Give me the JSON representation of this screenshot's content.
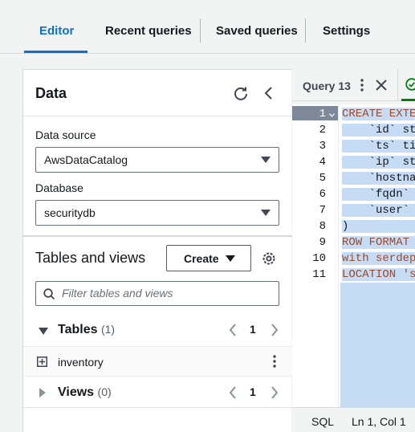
{
  "tabs": [
    {
      "label": "Editor",
      "active": true
    },
    {
      "label": "Recent queries",
      "active": false
    },
    {
      "label": "Saved queries",
      "active": false
    },
    {
      "label": "Settings",
      "active": false
    }
  ],
  "data_panel": {
    "title": "Data",
    "data_source": {
      "label": "Data source",
      "value": "AwsDataCatalog"
    },
    "database": {
      "label": "Database",
      "value": "securitydb"
    },
    "tables_and_views": {
      "title": "Tables and views",
      "create_label": "Create",
      "filter_placeholder": "Filter tables and views"
    },
    "tables_group": {
      "label": "Tables",
      "count": "(1)",
      "page": "1"
    },
    "table_items": [
      {
        "label": "inventory"
      }
    ],
    "views_group": {
      "label": "Views",
      "count": "(0)",
      "page": "1"
    }
  },
  "editor": {
    "query_tab": "Query 13",
    "lines": [
      {
        "n": "1",
        "text": "CREATE EXTE"
      },
      {
        "n": "2",
        "text": "    `id` st"
      },
      {
        "n": "3",
        "text": "    `ts` ti"
      },
      {
        "n": "4",
        "text": "    `ip` st"
      },
      {
        "n": "5",
        "text": "    `hostna"
      },
      {
        "n": "6",
        "text": "    `fqdn` "
      },
      {
        "n": "7",
        "text": "    `user` "
      },
      {
        "n": "8",
        "text": ")"
      },
      {
        "n": "9",
        "text": "ROW FORMAT "
      },
      {
        "n": "10",
        "text": "with serdep"
      },
      {
        "n": "11",
        "text": "LOCATION 's"
      }
    ],
    "status_language": "SQL",
    "status_position": "Ln 1, Col 1"
  },
  "colors": {
    "accent": "#0972d3",
    "selection": "#c6dcf5",
    "success": "#037f0c"
  },
  "icons": [
    "refresh-icon",
    "collapse-left-icon",
    "gear-icon",
    "search-icon",
    "expand-plus-icon",
    "more-vertical-icon",
    "close-icon",
    "success-check-icon"
  ]
}
